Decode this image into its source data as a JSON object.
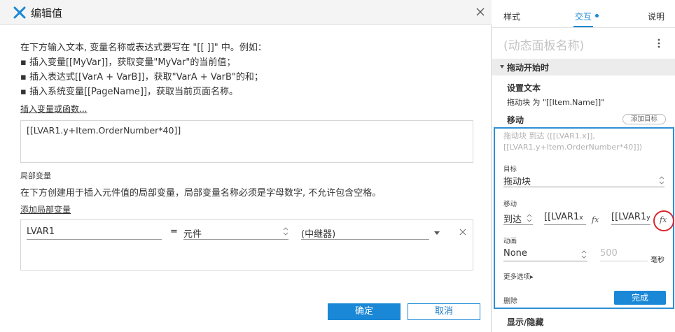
{
  "dialog": {
    "title": "编辑值",
    "instructions": [
      "在下方输入文本, 变量名称或表达式要写在 \"[[ ]]\" 中。例如：",
      "▪ 插入变量[[MyVar]]，获取变量\"MyVar\"的当前值；",
      "▪ 插入表达式[[VarA + VarB]]，获取\"VarA + VarB\"的和；",
      "▪ 插入系统变量[[PageName]]，获取当前页面名称。"
    ],
    "insert_link": "插入变量或函数...",
    "expression": "[[LVAR1.y+Item.OrderNumber*40]]",
    "local_vars_label": "局部变量",
    "local_vars_desc": "在下方创建用于插入元件值的局部变量，局部变量名称必须是字母数字, 不允许包含空格。",
    "add_local_link": "添加局部变量",
    "local_var": {
      "name": "LVAR1",
      "equals": "=",
      "type": "元件",
      "target": "(中继器)"
    },
    "ok_label": "确定",
    "cancel_label": "取消"
  },
  "panel": {
    "tabs": [
      "样式",
      "交互",
      "说明"
    ],
    "active_tab": "交互",
    "accent": "#1a88d6",
    "panel_name": "(动态面板名称)",
    "event": "拖动开始时",
    "set_text": {
      "title": "设置文本",
      "desc": "拖动块 为 \"[[Item.Name]]\""
    },
    "move": {
      "title": "移动",
      "add_target": "添加目标",
      "desc": "拖动块 到达 ([[LVAR1.x]],[[LVAR1.y+Item.OrderNumber*40]])",
      "target_label": "目标",
      "target_value": "拖动块",
      "move_label": "移动",
      "mode": "到达",
      "x_value": "[[LVAR1",
      "x_suffix": "x",
      "y_value": "[[LVAR1",
      "y_suffix": "y",
      "fx_symbol": "fx",
      "anim_label": "动画",
      "anim_value": "None",
      "duration": "500",
      "duration_unit": "毫秒",
      "more_options": "更多选项▸",
      "delete": "删除",
      "done": "完成"
    },
    "next_action": "显示/隐藏"
  }
}
